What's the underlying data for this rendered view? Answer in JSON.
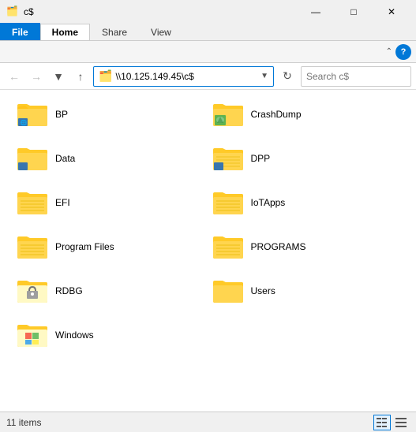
{
  "titleBar": {
    "icon": "📁",
    "title": "c$",
    "controls": {
      "minimize": "—",
      "maximize": "□",
      "close": "✕"
    }
  },
  "ribbon": {
    "tabs": [
      {
        "id": "file",
        "label": "File",
        "active": false,
        "isFile": true
      },
      {
        "id": "home",
        "label": "Home",
        "active": true
      },
      {
        "id": "share",
        "label": "Share",
        "active": false
      },
      {
        "id": "view",
        "label": "View",
        "active": false
      }
    ]
  },
  "addressBar": {
    "path": "\\\\10.125.149.45\\c$",
    "searchPlaceholder": "Search c$"
  },
  "folders": [
    {
      "id": "bp",
      "name": "BP",
      "type": "network",
      "col": 0
    },
    {
      "id": "crashdump",
      "name": "CrashDump",
      "type": "special",
      "col": 1
    },
    {
      "id": "data",
      "name": "Data",
      "type": "network",
      "col": 0
    },
    {
      "id": "dpp",
      "name": "DPP",
      "type": "network2",
      "col": 1
    },
    {
      "id": "efi",
      "name": "EFI",
      "type": "striped",
      "col": 0
    },
    {
      "id": "iotapps",
      "name": "IoTApps",
      "type": "striped",
      "col": 1
    },
    {
      "id": "programfiles",
      "name": "Program Files",
      "type": "striped",
      "col": 0
    },
    {
      "id": "programs",
      "name": "PROGRAMS",
      "type": "striped",
      "col": 1
    },
    {
      "id": "rdbg",
      "name": "RDBG",
      "type": "light",
      "col": 0
    },
    {
      "id": "users",
      "name": "Users",
      "type": "plain",
      "col": 1
    },
    {
      "id": "windows",
      "name": "Windows",
      "type": "light2",
      "col": 0
    }
  ],
  "statusBar": {
    "itemCount": "11 items"
  }
}
